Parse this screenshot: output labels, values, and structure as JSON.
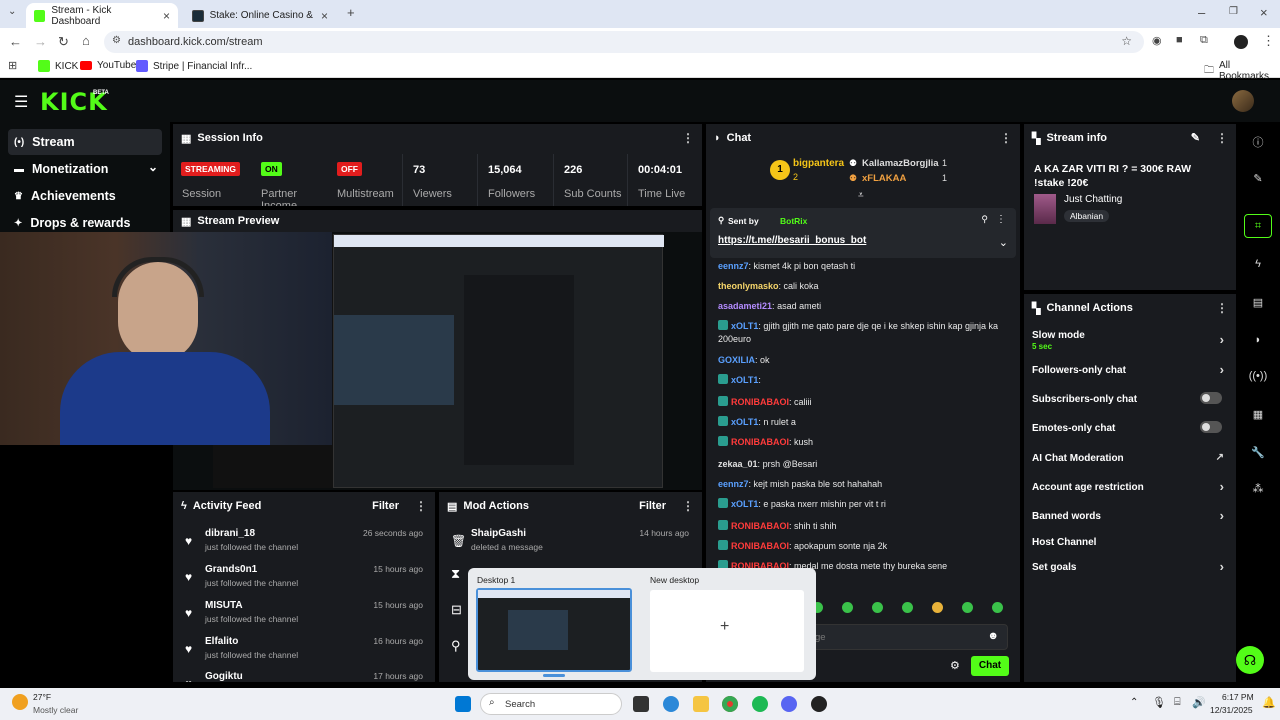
{
  "browser": {
    "tabs": [
      {
        "title": "Stream - Kick Dashboard",
        "active": true
      },
      {
        "title": "Stake: Online Casino & Sports",
        "active": false
      }
    ],
    "url": "dashboard.kick.com/stream",
    "bookmarks": [
      "KICK",
      "YouTube",
      "Stripe | Financial Infr...",
      "All Bookmarks"
    ]
  },
  "header": {
    "logo": "KICK",
    "beta": "BETA"
  },
  "sidebar": {
    "items": [
      {
        "label": "Stream",
        "icon": "broadcast-icon",
        "active": true
      },
      {
        "label": "Monetization",
        "icon": "money-icon"
      },
      {
        "label": "Achievements",
        "icon": "trophy-icon"
      },
      {
        "label": "Drops & rewards",
        "icon": "gift-icon"
      }
    ]
  },
  "session": {
    "title": "Session Info",
    "streaming_badge": "STREAMING",
    "streaming_label": "Session",
    "partner_badge": "ON",
    "partner_label": "Partner Income",
    "multistream_badge": "OFF",
    "multistream_label": "Multistream",
    "stats": [
      {
        "value": "73",
        "label": "Viewers"
      },
      {
        "value": "15,064",
        "label": "Followers"
      },
      {
        "value": "226",
        "label": "Sub Counts"
      },
      {
        "value": "00:04:01",
        "label": "Time Live"
      }
    ]
  },
  "preview": {
    "title": "Stream Preview"
  },
  "activity": {
    "title": "Activity Feed",
    "filter": "Filter",
    "items": [
      {
        "name": "dibrani_18",
        "action": "just followed the channel",
        "time": "26 seconds ago"
      },
      {
        "name": "Grands0n1",
        "action": "just followed the channel",
        "time": "15 hours ago"
      },
      {
        "name": "MISUTA",
        "action": "just followed the channel",
        "time": "15 hours ago"
      },
      {
        "name": "Elfalito",
        "action": "just followed the channel",
        "time": "16 hours ago"
      },
      {
        "name": "Gogiktu",
        "action": "",
        "time": "17 hours ago"
      }
    ]
  },
  "mod_actions": {
    "title": "Mod Actions",
    "filter": "Filter",
    "items": [
      {
        "name": "ShaipGashi",
        "action": "deleted a message",
        "time": "14 hours ago"
      }
    ]
  },
  "chat": {
    "title": "Chat",
    "leaderboard": [
      {
        "name": "bigpantera",
        "count": "2"
      },
      {
        "name": "KallamazBorgjlia",
        "count": "1"
      },
      {
        "name": "xFLAKAA",
        "count": "1"
      }
    ],
    "pinned": {
      "sent_by": "Sent by",
      "user": "BotRix",
      "text": "https://t.me//besarii_bonus_bot"
    },
    "messages": [
      {
        "user": "eennz7",
        "color": "#5aa0ff",
        "text": "kismet 4k pi bon qetash ti"
      },
      {
        "user": "theonlymasko",
        "color": "#f5d56a",
        "text": "cali koka"
      },
      {
        "user": "asadameti21",
        "color": "#b48cff",
        "text": "asad ameti"
      },
      {
        "user": "xOLT1",
        "color": "#5aa0ff",
        "text": "gjith gjith me qato pare dje qe i ke shkep ishin kap gjinja ka 200euro"
      },
      {
        "user": "GOXILIA",
        "color": "#5aa0ff",
        "text": "ok"
      },
      {
        "user": "xOLT1",
        "color": "#5aa0ff",
        "text": ""
      },
      {
        "user": "RONIBABAOI",
        "color": "#ff3b3b",
        "text": "caliii"
      },
      {
        "user": "xOLT1",
        "color": "#5aa0ff",
        "text": "n rulet a"
      },
      {
        "user": "RONIBABAOI",
        "color": "#ff3b3b",
        "text": "kush"
      },
      {
        "user": "zekaa_01",
        "color": "#e0e0e0",
        "text": "prsh @Besari"
      },
      {
        "user": "eennz7",
        "color": "#5aa0ff",
        "text": "kejt mish paska ble sot hahahah"
      },
      {
        "user": "xOLT1",
        "color": "#5aa0ff",
        "text": "e paska nxerr mishin per vit t ri"
      },
      {
        "user": "RONIBABAOI",
        "color": "#ff3b3b",
        "text": "shih ti shih"
      },
      {
        "user": "RONIBABAOI",
        "color": "#ff3b3b",
        "text": "apokapum sonte nja 2k"
      },
      {
        "user": "RONIBABAOI",
        "color": "#ff3b3b",
        "text": "medal me dosta mete thy bureka sene"
      }
    ],
    "input_placeholder": "ge",
    "send_label": "Chat"
  },
  "stream_info": {
    "title": "Stream info",
    "stream_title": "A KA ZAR VITI RI ? = 300€ RAW !stake !20€",
    "category": "Just Chatting",
    "tag": "Albanian"
  },
  "channel_actions": {
    "title": "Channel Actions",
    "items": [
      {
        "label": "Slow mode",
        "sub": "5 sec",
        "control": "chevron"
      },
      {
        "label": "Followers-only chat",
        "control": "chevron"
      },
      {
        "label": "Subscribers-only chat",
        "control": "toggle"
      },
      {
        "label": "Emotes-only chat",
        "control": "toggle"
      },
      {
        "label": "AI Chat Moderation",
        "control": "external"
      },
      {
        "label": "Account age restriction",
        "control": "chevron"
      },
      {
        "label": "Banned words",
        "control": "chevron"
      },
      {
        "label": "Host Channel",
        "control": "none"
      },
      {
        "label": "Set goals",
        "control": "chevron"
      }
    ]
  },
  "desktops": {
    "items": [
      "Desktop 1",
      "New desktop"
    ],
    "add": "+"
  },
  "taskbar": {
    "weather_temp": "27°F",
    "weather_desc": "Mostly clear",
    "search": "Search",
    "time": "6:17 PM",
    "date": "12/31/2025"
  },
  "colors": {
    "kick_green": "#53fc18",
    "panel": "#191b1f",
    "bg": "#000000",
    "streaming_red": "#e21d1d"
  }
}
